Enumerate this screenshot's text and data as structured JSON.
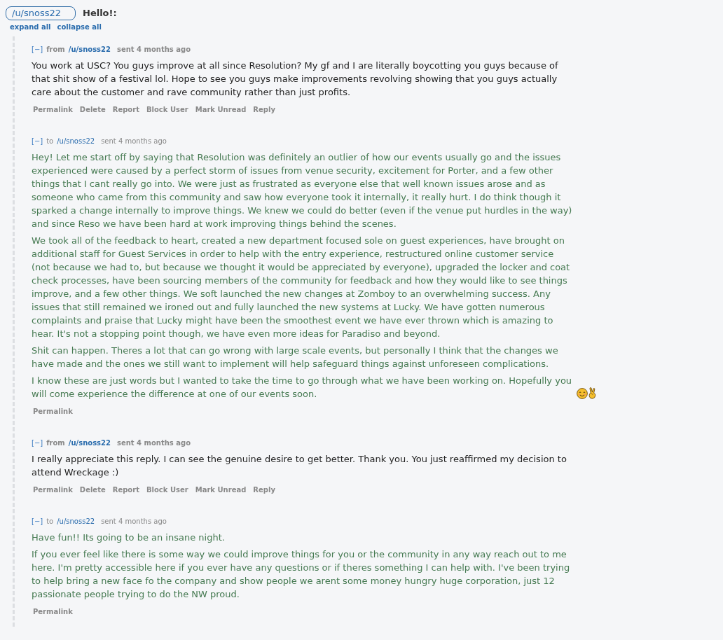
{
  "header": {
    "user": "/u/snoss22",
    "subject": "Hello!:"
  },
  "thread_links": [
    "expand all",
    "collapse all"
  ],
  "messages": [
    {
      "kind": "from",
      "toggle": "[−]",
      "direction": "from",
      "user": "/u/snoss22",
      "time": "sent 4 months ago",
      "emoji": false,
      "paragraphs": [
        "You work at USC? You guys improve at all since Resolution? My gf and I are literally boycotting you guys because of that shit show of a festival lol. Hope to see you guys make improvements revolving showing that you guys actually care about the customer and rave community rather than just profits."
      ],
      "actions": [
        "Permalink",
        "Delete",
        "Report",
        "Block User",
        "Mark Unread",
        "Reply"
      ]
    },
    {
      "kind": "to",
      "toggle": "[−]",
      "direction": "to",
      "user": "/u/snoss22",
      "time": "sent 4 months ago",
      "emoji": true,
      "paragraphs": [
        "Hey! Let me start off by saying that Resolution was definitely an outlier of how our events usually go and the issues experienced were caused by a perfect storm of issues from venue security, excitement for Porter, and a few other things that I cant really go into. We were just as frustrated as everyone else that well known issues arose and as someone who came from this community and saw how everyone took it internally, it really hurt. I do think though it sparked a change internally to improve things. We knew we could do better (even if the venue put hurdles in the way) and since Reso we have been hard at work improving things behind the scenes.",
        "We took all of the feedback to heart, created a new department focused sole on guest experiences, have brought on additional staff for Guest Services in order to help with the entry experience, restructured online customer service (not because we had to, but because we thought it would be appreciated by everyone), upgraded the locker and coat check processes, have been sourcing members of the community for feedback and how they would like to see things improve, and a few other things. We soft launched the new changes at Zomboy to an overwhelming success. Any issues that still remained we ironed out and fully launched the new systems at Lucky. We have gotten numerous complaints and praise that Lucky might have been the smoothest event we have ever thrown which is amazing to hear. It's not a stopping point though, we have even more ideas for Paradiso and beyond.",
        "Shit can happen. Theres a lot that can go wrong with large scale events, but personally I think that the changes we have made and the ones we still want to implement will help safeguard things against unforeseen complications.",
        "I know these are just words but I wanted to take the time to go through what we have been working on. Hopefully you will come experience the difference at one of our events soon."
      ],
      "actions": [
        "Permalink"
      ]
    },
    {
      "kind": "from",
      "toggle": "[−]",
      "direction": "from",
      "user": "/u/snoss22",
      "time": "sent 4 months ago",
      "emoji": false,
      "paragraphs": [
        "I really appreciate this reply. I can see the genuine desire to get better. Thank you. You just reaffirmed my decision to attend Wreckage :)"
      ],
      "actions": [
        "Permalink",
        "Delete",
        "Report",
        "Block User",
        "Mark Unread",
        "Reply"
      ]
    },
    {
      "kind": "to",
      "toggle": "[−]",
      "direction": "to",
      "user": "/u/snoss22",
      "time": "sent 4 months ago",
      "emoji": false,
      "paragraphs": [
        "Have fun!! Its going to be an insane night.",
        "If you ever feel like there is some way we could improve things for you or the community in any way reach out to me here. I'm pretty accessible here if you ever have any questions or if theres something I can help with. I've been trying to help bring a new face fo the company and show people we arent some money hungry huge corporation, just 12 passionate people trying to do the NW proud."
      ],
      "actions": [
        "Permalink"
      ]
    }
  ]
}
